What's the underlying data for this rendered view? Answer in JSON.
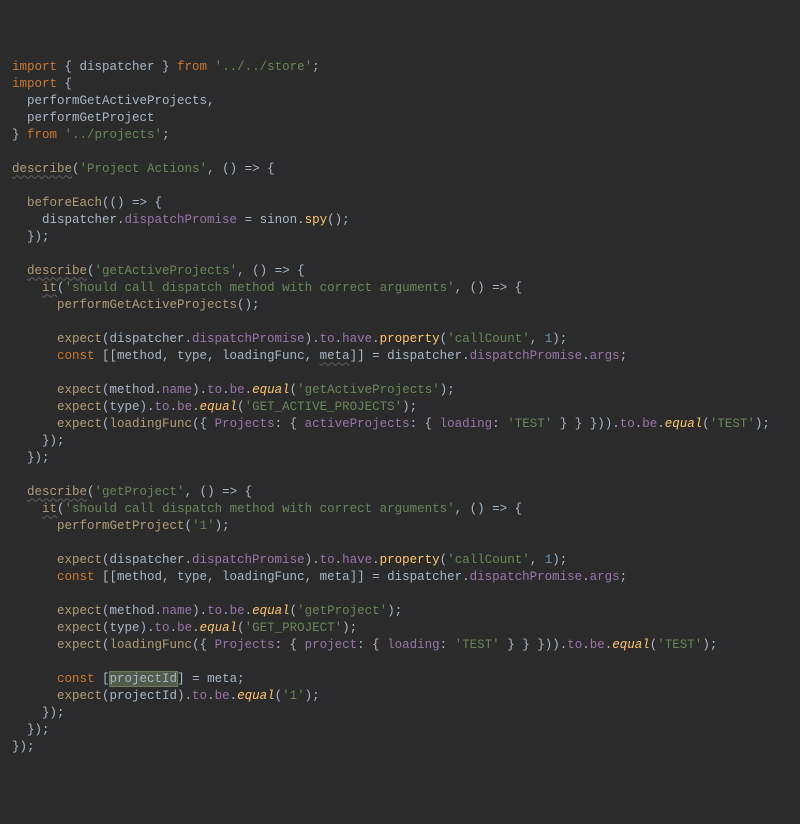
{
  "code": {
    "l1": {
      "a": "import",
      "b": " { dispatcher } ",
      "c": "from ",
      "d": "'../../store'",
      "e": ";"
    },
    "l2": {
      "a": "import",
      "b": " {"
    },
    "l3": "  performGetActiveProjects,",
    "l4": "  performGetProject",
    "l5": {
      "a": "} ",
      "b": "from ",
      "c": "'../projects'",
      "d": ";"
    },
    "l6": "",
    "l7": {
      "a": "describe",
      "b": "(",
      "c": "'Project Actions'",
      "d": ", () => {"
    },
    "l8": "",
    "l9": {
      "a": "  ",
      "b": "beforeEach",
      "c": "(() => {"
    },
    "l10": {
      "a": "    dispatcher.",
      "b": "dispatchPromise ",
      "c": "= sinon.",
      "d": "spy",
      "e": "();"
    },
    "l11": "  });",
    "l12": "",
    "l13": {
      "a": "  ",
      "b": "describe",
      "c": "(",
      "d": "'getActiveProjects'",
      "e": ", () => {"
    },
    "l14": {
      "a": "    ",
      "b": "it",
      "c": "(",
      "d": "'should call dispatch method with correct arguments'",
      "e": ", () => {"
    },
    "l15": {
      "a": "      ",
      "b": "performGetActiveProjects",
      "c": "();"
    },
    "l16": "",
    "l17": {
      "a": "      ",
      "b": "expect",
      "c": "(dispatcher.",
      "d": "dispatchPromise",
      "e": ").",
      "f": "to",
      "g": ".",
      "h": "have",
      "i": ".",
      "j": "property",
      "k": "(",
      "l": "'callCount'",
      "m": ", ",
      "n": "1",
      "o": ");"
    },
    "l18": {
      "a": "      ",
      "b": "const ",
      "c": "[[method, type, loadingFunc, ",
      "d": "meta",
      "e": "]] = dispatcher.",
      "f": "dispatchPromise",
      "g": ".",
      "h": "args",
      "i": ";"
    },
    "l19": "",
    "l20": {
      "a": "      ",
      "b": "expect",
      "c": "(method.",
      "d": "name",
      "e": ").",
      "f": "to",
      "g": ".",
      "h": "be",
      "i": ".",
      "j": "equal",
      "k": "(",
      "l": "'getActiveProjects'",
      "m": ");"
    },
    "l21": {
      "a": "      ",
      "b": "expect",
      "c": "(type).",
      "d": "to",
      "e": ".",
      "f": "be",
      "g": ".",
      "h": "equal",
      "i": "(",
      "j": "'GET_ACTIVE_PROJECTS'",
      "k": ");"
    },
    "l22": {
      "a": "      ",
      "b": "expect",
      "c": "(",
      "d": "loadingFunc",
      "e": "({ ",
      "f": "Projects",
      "g": ": { ",
      "h": "activeProjects",
      "i": ": { ",
      "j": "loading",
      "k": ": ",
      "l": "'TEST' ",
      "m": "} } })).",
      "n": "to",
      "o": ".",
      "p": "be",
      "q": ".",
      "r": "equal",
      "s": "(",
      "t": "'TEST'",
      "u": ");"
    },
    "l23": "    });",
    "l24": "  });",
    "l25": "",
    "l26": {
      "a": "  ",
      "b": "describe",
      "c": "(",
      "d": "'getProject'",
      "e": ", () => {"
    },
    "l27": {
      "a": "    ",
      "b": "it",
      "c": "(",
      "d": "'should call dispatch method with correct arguments'",
      "e": ", () => {"
    },
    "l28": {
      "a": "      ",
      "b": "performGetProject",
      "c": "(",
      "d": "'1'",
      "e": ");"
    },
    "l29": "",
    "l30": {
      "a": "      ",
      "b": "expect",
      "c": "(dispatcher.",
      "d": "dispatchPromise",
      "e": ").",
      "f": "to",
      "g": ".",
      "h": "have",
      "i": ".",
      "j": "property",
      "k": "(",
      "l": "'callCount'",
      "m": ", ",
      "n": "1",
      "o": ");"
    },
    "l31": {
      "a": "      ",
      "b": "const ",
      "c": "[[method, type, loadingFunc, meta]] = dispatcher.",
      "d": "dispatchPromise",
      "e": ".",
      "f": "args",
      "g": ";"
    },
    "l32": "",
    "l33": {
      "a": "      ",
      "b": "expect",
      "c": "(method.",
      "d": "name",
      "e": ").",
      "f": "to",
      "g": ".",
      "h": "be",
      "i": ".",
      "j": "equal",
      "k": "(",
      "l": "'getProject'",
      "m": ");"
    },
    "l34": {
      "a": "      ",
      "b": "expect",
      "c": "(type).",
      "d": "to",
      "e": ".",
      "f": "be",
      "g": ".",
      "h": "equal",
      "i": "(",
      "j": "'GET_PROJECT'",
      "k": ");"
    },
    "l35": {
      "a": "      ",
      "b": "expect",
      "c": "(",
      "d": "loadingFunc",
      "e": "({ ",
      "f": "Projects",
      "g": ": { ",
      "h": "project",
      "i": ": { ",
      "j": "loading",
      "k": ": ",
      "l": "'TEST' ",
      "m": "} } })).",
      "n": "to",
      "o": ".",
      "p": "be",
      "q": ".",
      "r": "equal",
      "s": "(",
      "t": "'TEST'",
      "u": ");"
    },
    "l36": "",
    "l37": {
      "a": "      ",
      "b": "const ",
      "c": "[",
      "d": "projectId",
      "e": "] = meta;"
    },
    "l38": {
      "a": "      ",
      "b": "expect",
      "c": "(projectId).",
      "d": "to",
      "e": ".",
      "f": "be",
      "g": ".",
      "h": "equal",
      "i": "(",
      "j": "'1'",
      "k": ");"
    },
    "l39": "    });",
    "l40": "  });",
    "l41": "});"
  }
}
